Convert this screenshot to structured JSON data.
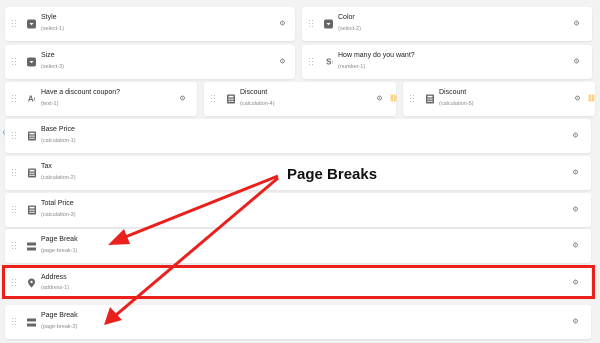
{
  "fields": {
    "style": {
      "title": "Style",
      "sub": "(select-1)"
    },
    "color": {
      "title": "Color",
      "sub": "(select-2)"
    },
    "size": {
      "title": "Size",
      "sub": "(select-3)"
    },
    "how_many": {
      "title": "How many do you want?",
      "sub": "(number-1)"
    },
    "coupon": {
      "title": "Have a discount coupon?",
      "sub": "(text-1)"
    },
    "discount4": {
      "title": "Discount",
      "sub": "(calculation-4)"
    },
    "discount5": {
      "title": "Discount",
      "sub": "(calculation-5)"
    },
    "base": {
      "title": "Base Price",
      "sub": "(calculation-1)"
    },
    "tax": {
      "title": "Tax",
      "sub": "(calculation-2)"
    },
    "total": {
      "title": "Total Price",
      "sub": "(calculation-3)"
    },
    "pb1": {
      "title": "Page Break",
      "sub": "(page-break-1)"
    },
    "address": {
      "title": "Address",
      "sub": "(address-1)"
    },
    "pb2": {
      "title": "Page Break",
      "sub": "(page-break-2)"
    }
  },
  "annotation": {
    "label": "Page Breaks"
  },
  "colors": {
    "highlight": "#e9201c",
    "link_icon": "#f0a500",
    "refresh_icon": "#2a8bd6"
  },
  "icons": {
    "select": "select-icon",
    "number": "number-icon",
    "text": "text-icon",
    "calculation": "calculator-icon",
    "page_break": "page-break-icon",
    "address": "location-pin-icon",
    "settings": "gear-icon",
    "link": "link-icon",
    "drag": "drag-handle-icon",
    "refresh": "refresh-icon"
  }
}
